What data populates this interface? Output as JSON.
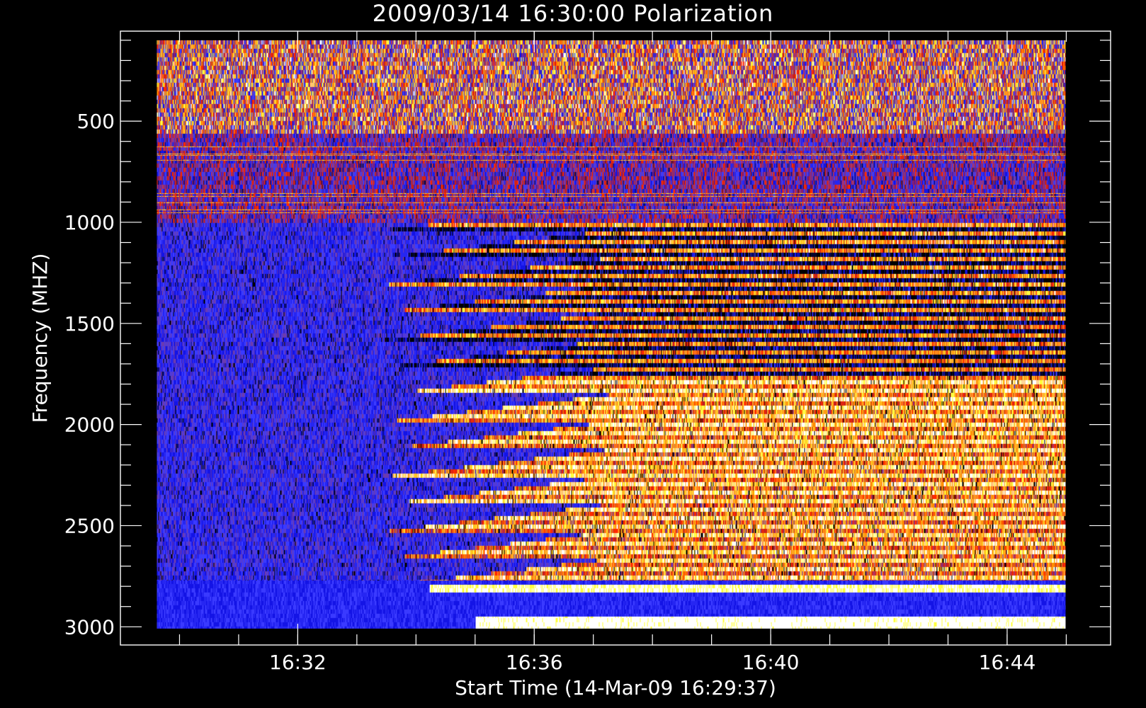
{
  "chart_data": {
    "type": "heatmap",
    "title": "2009/03/14 16:30:00 Polarization",
    "xlabel": "Start Time (14-Mar-09 16:29:37)",
    "ylabel": "Frequency (MHZ)",
    "x_start": "16:29:37",
    "x_end": "16:44:59",
    "xlim": [
      "16:29:00",
      "16:45:45"
    ],
    "ylim": [
      3090,
      55
    ],
    "x_ticks": [
      "16:32",
      "16:36",
      "16:40",
      "16:44"
    ],
    "y_ticks": [
      500,
      1000,
      1500,
      2000,
      2500,
      3000
    ],
    "y_range": [
      100,
      3010
    ],
    "colors": {
      "background": "#000000",
      "foreground": "#ffffff",
      "colormap": [
        "#000000",
        "#0a0a5a",
        "#1414e6",
        "#3a3aff",
        "#6a3ab0",
        "#c02020",
        "#ff2a00",
        "#ff8c00",
        "#ffb030",
        "#ffff40",
        "#ffffff"
      ]
    },
    "features": [
      {
        "from_freq": 100,
        "to_freq": 560,
        "description": "broadband noise"
      },
      {
        "from_freq": 560,
        "to_freq": 1000,
        "description": "blue/purple with red lines"
      },
      {
        "from_freq": 2790,
        "to_freq": 2800,
        "description": "white saturated band after 16:34"
      },
      {
        "from_freq": 2950,
        "to_freq": 3000,
        "description": "white saturated band after 16:35"
      }
    ]
  }
}
